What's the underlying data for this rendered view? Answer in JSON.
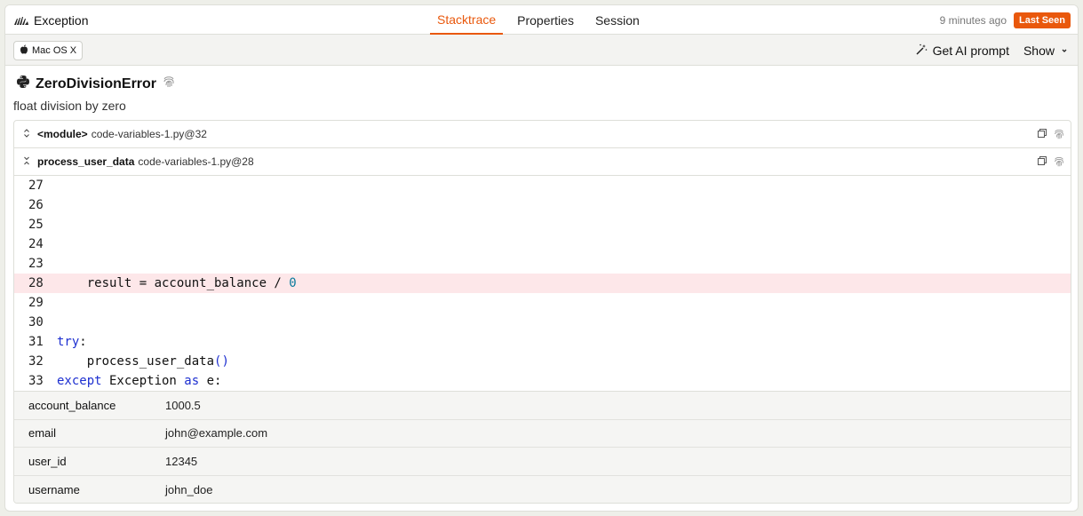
{
  "header": {
    "title": "Exception",
    "tabs": [
      {
        "label": "Stacktrace",
        "active": true
      },
      {
        "label": "Properties",
        "active": false
      },
      {
        "label": "Session",
        "active": false
      }
    ],
    "time_ago": "9 minutes ago",
    "badge": "Last Seen"
  },
  "toolbar": {
    "os_label": "Mac OS X",
    "ai_prompt_label": "Get AI prompt",
    "show_label": "Show"
  },
  "error": {
    "type": "ZeroDivisionError",
    "message": "float division by zero"
  },
  "frames": [
    {
      "function": "<module>",
      "location": "code-variables-1.py@32"
    },
    {
      "function": "process_user_data",
      "location": "code-variables-1.py@28"
    }
  ],
  "code_lines": [
    {
      "no": "27",
      "text": ""
    },
    {
      "no": "26",
      "text": ""
    },
    {
      "no": "25",
      "text": ""
    },
    {
      "no": "24",
      "text": ""
    },
    {
      "no": "23",
      "text": ""
    },
    {
      "no": "28",
      "text": "    result = account_balance / 0"
    },
    {
      "no": "29",
      "text": ""
    },
    {
      "no": "30",
      "text": ""
    },
    {
      "no": "31",
      "text": "try:"
    },
    {
      "no": "32",
      "text": "    process_user_data()"
    },
    {
      "no": "33",
      "text": "except Exception as e:"
    }
  ],
  "variables": [
    {
      "name": "account_balance",
      "value": "1000.5"
    },
    {
      "name": "email",
      "value": "john@example.com"
    },
    {
      "name": "user_id",
      "value": "12345"
    },
    {
      "name": "username",
      "value": "john_doe"
    }
  ],
  "colors": {
    "accent": "#e9580c",
    "highlight_line": "#fde7e9",
    "keyword": "#1d2fd0"
  }
}
